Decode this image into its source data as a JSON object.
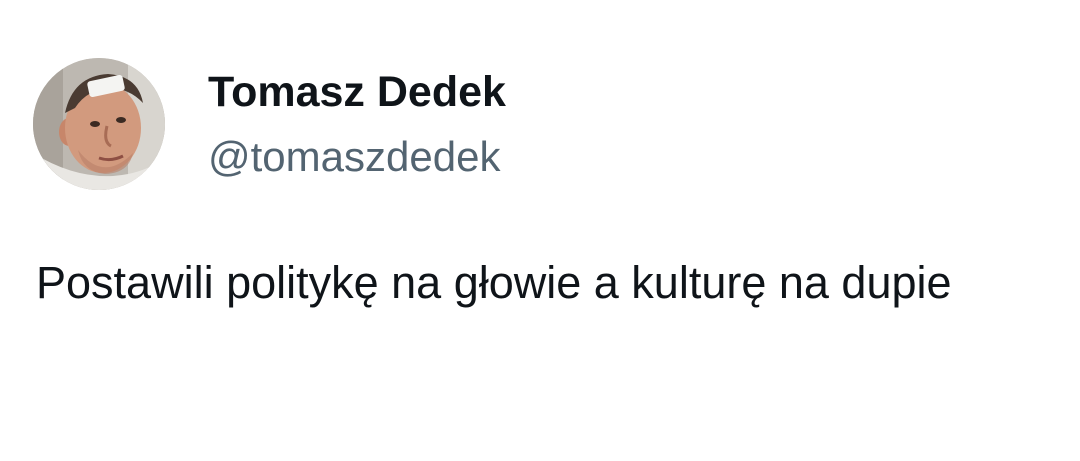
{
  "author": {
    "display_name": "Tomasz Dedek",
    "handle": "@tomaszdedek",
    "avatar_icon": "profile-photo-avatar"
  },
  "tweet": {
    "text": "Postawili politykę na głowie a kulturę na dupie"
  },
  "colors": {
    "background": "#ffffff",
    "name": "#0f1419",
    "handle": "#536471",
    "text": "#0f1419"
  }
}
